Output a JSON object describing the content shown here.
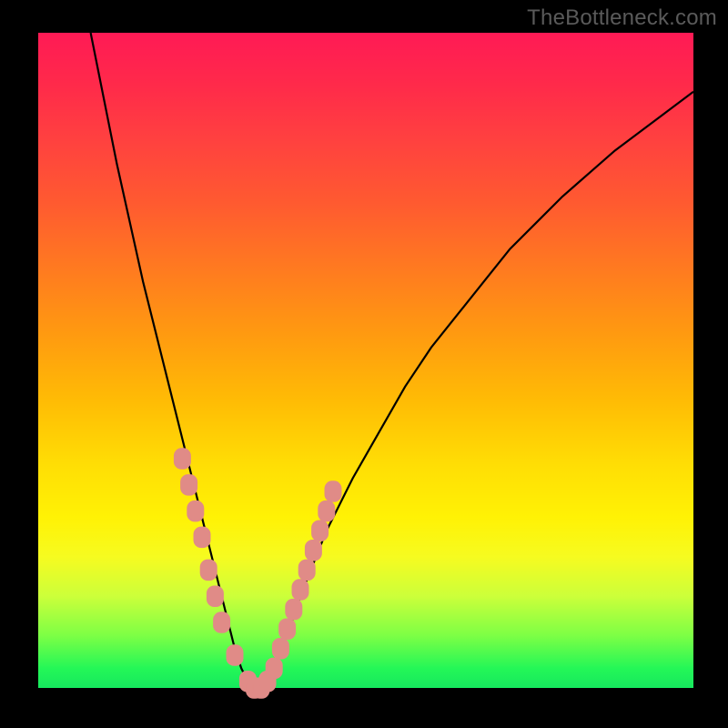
{
  "watermark": "TheBottleneck.com",
  "colors": {
    "gradient_top": "#ff1a55",
    "gradient_mid1": "#ff9a10",
    "gradient_mid2": "#fff205",
    "gradient_bottom": "#16e85e",
    "curve": "#000000",
    "markers": "#e08b87",
    "frame": "#000000"
  },
  "chart_data": {
    "type": "line",
    "title": "",
    "xlabel": "",
    "ylabel": "",
    "xlim": [
      0,
      100
    ],
    "ylim": [
      0,
      100
    ],
    "grid": false,
    "series": [
      {
        "name": "curve",
        "x": [
          8,
          10,
          12,
          14,
          16,
          18,
          20,
          22,
          24,
          25,
          26,
          27,
          28,
          29,
          30,
          31,
          32,
          33,
          34,
          35,
          36,
          38,
          40,
          44,
          48,
          52,
          56,
          60,
          64,
          68,
          72,
          76,
          80,
          84,
          88,
          92,
          96,
          100
        ],
        "values": [
          100,
          90,
          80,
          71,
          62,
          54,
          46,
          38,
          30,
          26,
          22,
          18,
          14,
          10,
          6,
          3,
          1,
          0,
          0,
          1,
          3,
          8,
          14,
          24,
          32,
          39,
          46,
          52,
          57,
          62,
          67,
          71,
          75,
          78.5,
          82,
          85,
          88,
          91
        ]
      }
    ],
    "markers": [
      {
        "x": 22,
        "y": 35
      },
      {
        "x": 23,
        "y": 31
      },
      {
        "x": 24,
        "y": 27
      },
      {
        "x": 25,
        "y": 23
      },
      {
        "x": 26,
        "y": 18
      },
      {
        "x": 27,
        "y": 14
      },
      {
        "x": 28,
        "y": 10
      },
      {
        "x": 30,
        "y": 5
      },
      {
        "x": 32,
        "y": 1
      },
      {
        "x": 33,
        "y": 0
      },
      {
        "x": 34,
        "y": 0
      },
      {
        "x": 35,
        "y": 1
      },
      {
        "x": 36,
        "y": 3
      },
      {
        "x": 37,
        "y": 6
      },
      {
        "x": 38,
        "y": 9
      },
      {
        "x": 39,
        "y": 12
      },
      {
        "x": 40,
        "y": 15
      },
      {
        "x": 41,
        "y": 18
      },
      {
        "x": 42,
        "y": 21
      },
      {
        "x": 43,
        "y": 24
      },
      {
        "x": 44,
        "y": 27
      },
      {
        "x": 45,
        "y": 30
      }
    ],
    "marker_color": "#e08b87",
    "marker_radius_px": 9,
    "annotations": [
      {
        "text": "TheBottleneck.com",
        "position": "top-right"
      }
    ]
  }
}
